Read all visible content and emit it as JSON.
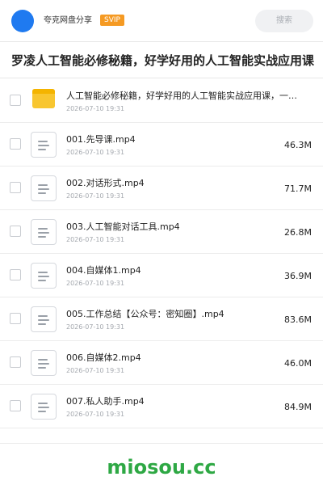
{
  "header": {
    "app_name": "夸克网盘分享",
    "badge": "SVIP",
    "search_placeholder": "搜索",
    "avatar_color": "#1f7af0",
    "badge_color": "#f59a23"
  },
  "page_title": "罗凌人工智能必修秘籍，好学好用的人工智能实战应用课",
  "files": [
    {
      "type": "folder",
      "icon": "folder-icon",
      "name": "人工智能必修秘籍，好学好用的人工智能实战应用课，一…",
      "date": "2026-07-10 19:31",
      "size": ""
    },
    {
      "type": "file",
      "icon": "document-icon",
      "name": "001.先导课.mp4",
      "date": "2026-07-10 19:31",
      "size": "46.3M"
    },
    {
      "type": "file",
      "icon": "document-icon",
      "name": "002.对话形式.mp4",
      "date": "2026-07-10 19:31",
      "size": "71.7M"
    },
    {
      "type": "file",
      "icon": "document-icon",
      "name": "003.人工智能对话工具.mp4",
      "date": "2026-07-10 19:31",
      "size": "26.8M"
    },
    {
      "type": "file",
      "icon": "document-icon",
      "name": "004.自媒体1.mp4",
      "date": "2026-07-10 19:31",
      "size": "36.9M"
    },
    {
      "type": "file",
      "icon": "document-icon",
      "name": "005.工作总结【公众号：密知圈】.mp4",
      "date": "2026-07-10 19:31",
      "size": "83.6M"
    },
    {
      "type": "file",
      "icon": "document-icon",
      "name": "006.自媒体2.mp4",
      "date": "2026-07-10 19:31",
      "size": "46.0M"
    },
    {
      "type": "file",
      "icon": "document-icon",
      "name": "007.私人助手.mp4",
      "date": "2026-07-10 19:31",
      "size": "84.9M"
    }
  ],
  "watermark": "miosou.cc",
  "watermark_color": "#2ea844"
}
